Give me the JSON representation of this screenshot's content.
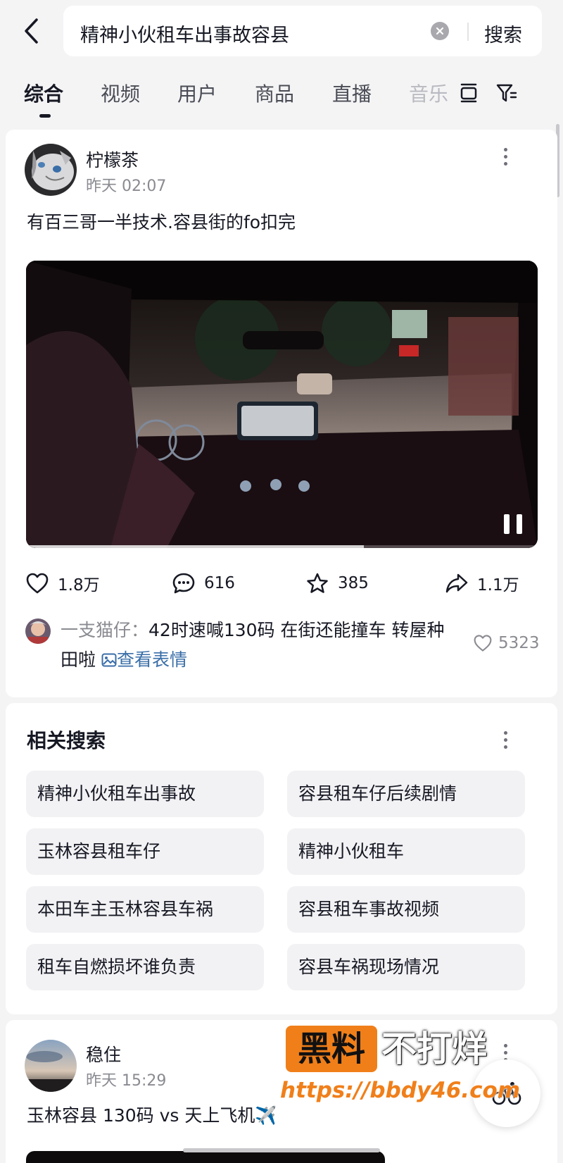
{
  "search": {
    "query": "精神小伙租车出事故容县",
    "button_label": "搜索"
  },
  "tabs": [
    {
      "label": "综合"
    },
    {
      "label": "视频"
    },
    {
      "label": "用户"
    },
    {
      "label": "商品"
    },
    {
      "label": "直播"
    },
    {
      "label": "音乐"
    }
  ],
  "post1": {
    "username": "柠檬茶",
    "timestamp": "昨天 02:07",
    "text": "有百三哥一半技术.容县街的fo扣完",
    "video_progress": 0.66,
    "actions": {
      "likes": "1.8万",
      "comments": "616",
      "favorites": "385",
      "shares": "1.1万"
    },
    "top_comment": {
      "author": "一支猫仔：",
      "text": "42时速喊130码 在街还能撞车 转屋种田啦",
      "view_emoji_label": "查看表情",
      "likes": "5323"
    }
  },
  "related": {
    "title": "相关搜索",
    "items": [
      "精神小伙租车出事故",
      "容县租车仔后续剧情",
      "玉林容县租车仔",
      "精神小伙租车",
      "本田车主玉林容县车祸",
      "容县租车事故视频",
      "租车自燃损坏谁负责",
      "容县车祸现场情况"
    ]
  },
  "post2": {
    "username": "稳住",
    "timestamp": "昨天 15:29",
    "text": "玉林容县 130码 vs 天上飞机✈️"
  },
  "watermark": {
    "box_text": "黑料",
    "text": "不打烊",
    "url": "https://bbdy46.com"
  },
  "colors": {
    "accent_orange": "#f07f1a",
    "link_blue": "#3a6ea8",
    "text_primary": "#161823",
    "text_secondary": "#8a8b91",
    "background": "#f4f4f5"
  }
}
